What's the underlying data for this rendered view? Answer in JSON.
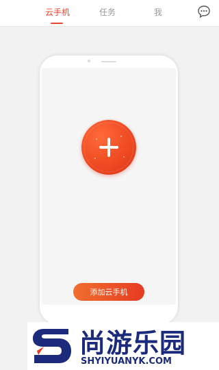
{
  "header": {
    "tabs": [
      {
        "label": "云手机",
        "active": true
      },
      {
        "label": "任务",
        "active": false
      },
      {
        "label": "我",
        "active": false
      }
    ],
    "message_icon": "chat-bubble-icon"
  },
  "main": {
    "add_icon": "plus-icon",
    "add_button_label": "添加云手机"
  },
  "watermark": {
    "title": "尚游乐园",
    "domain": "SHYIYUANYK.COM"
  },
  "colors": {
    "accent": "#e8452e",
    "watermark": "#1b2a7a"
  }
}
